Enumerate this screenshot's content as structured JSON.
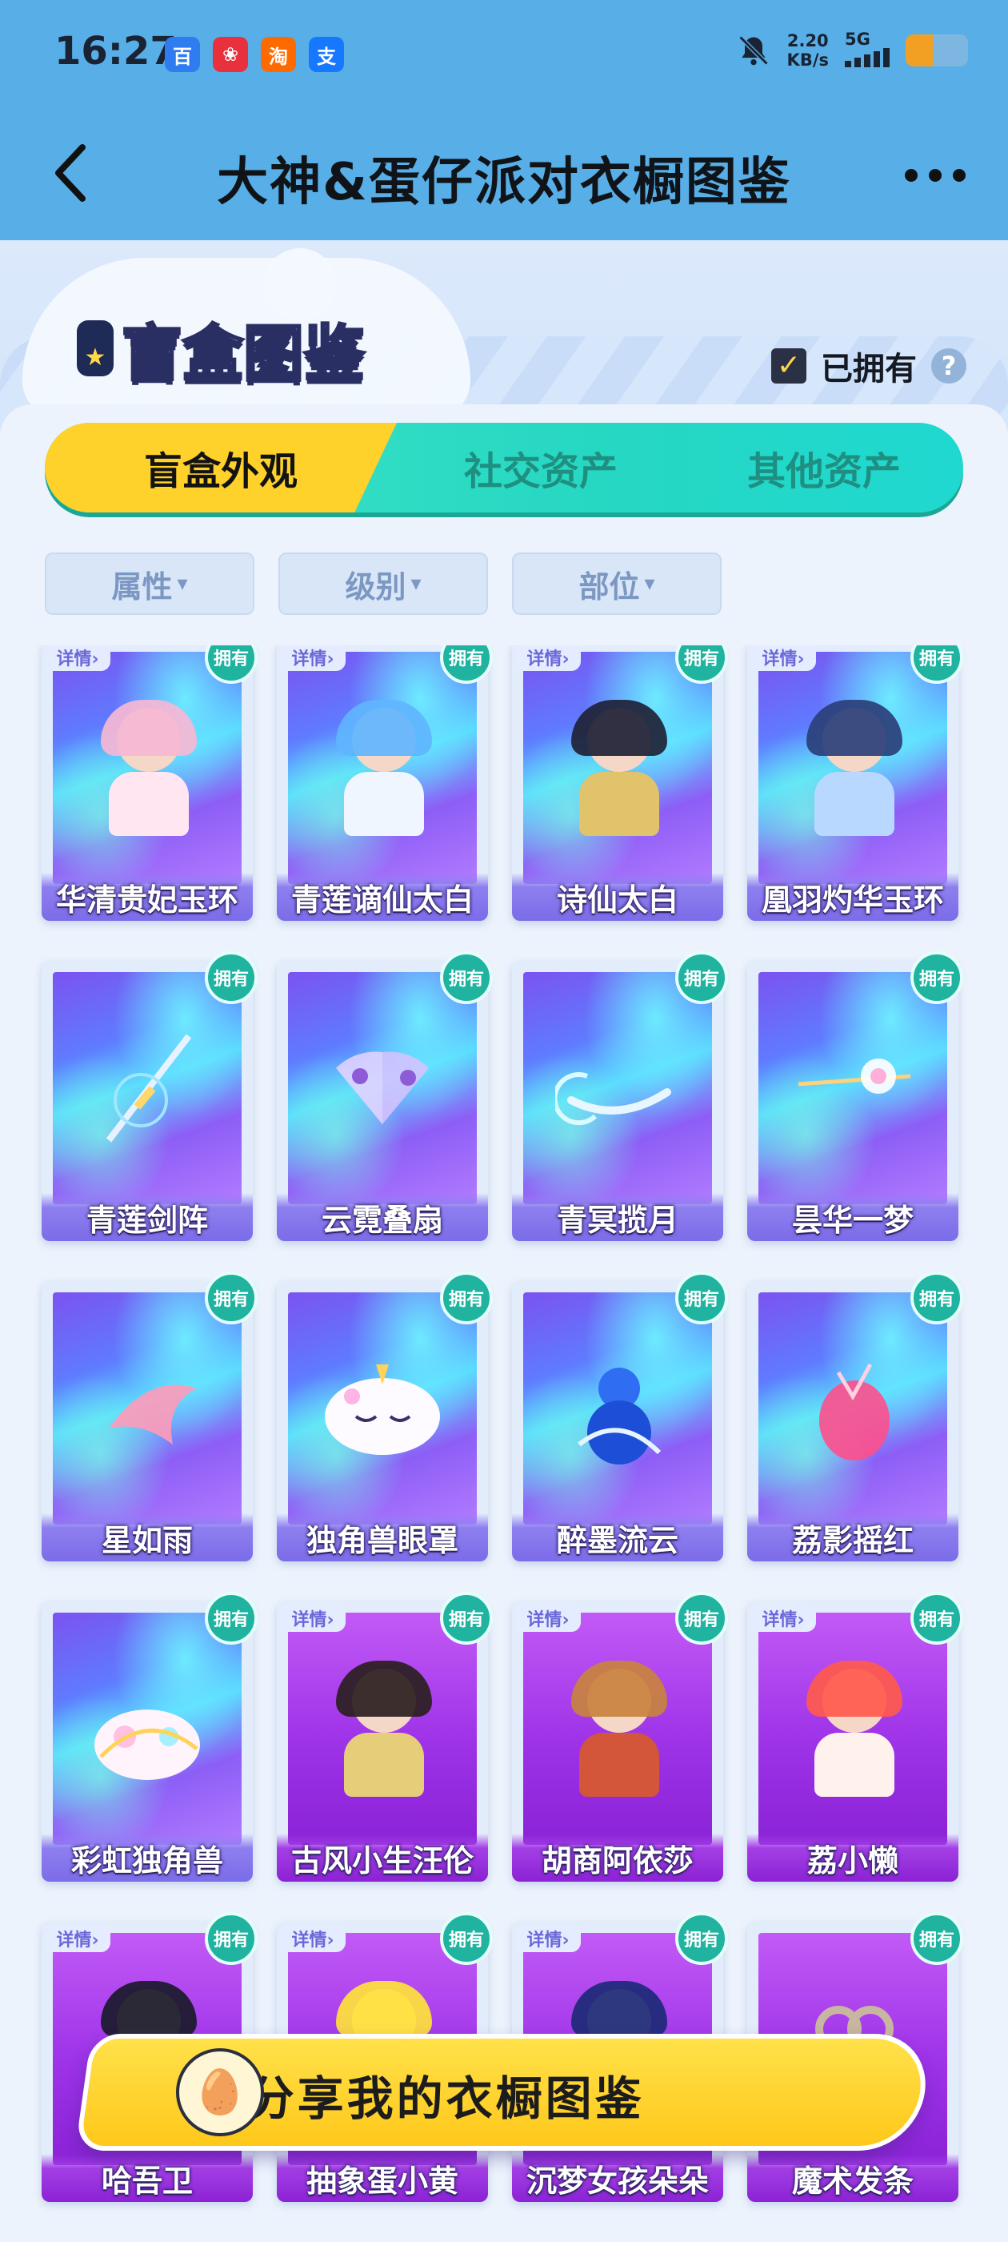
{
  "status_bar": {
    "time": "16:27",
    "apps": [
      {
        "name": "baidu",
        "glyph": "百",
        "color": "#2f7bf0"
      },
      {
        "name": "app-red",
        "glyph": "❀",
        "color": "#e8313c"
      },
      {
        "name": "taobao",
        "glyph": "淘",
        "color": "#ff6a00"
      },
      {
        "name": "alipay",
        "glyph": "支",
        "color": "#1677ff"
      }
    ],
    "net_speed_value": "2.20",
    "net_speed_unit": "KB/s",
    "signal": "5G"
  },
  "header": {
    "back_glyph": "‹",
    "title": "大神&蛋仔派对衣橱图鉴",
    "more_glyph": "•••"
  },
  "hero": {
    "logo_text": "盲盒图鉴",
    "owned_label": "已拥有",
    "owned_checked": true,
    "check_glyph": "✓",
    "help_glyph": "?"
  },
  "tabs": [
    {
      "label": "盲盒外观",
      "active": true
    },
    {
      "label": "社交资产",
      "active": false
    },
    {
      "label": "其他资产",
      "active": false
    }
  ],
  "filters": [
    {
      "label": "属性",
      "caret": "▾"
    },
    {
      "label": "级别",
      "caret": "▾"
    },
    {
      "label": "部位",
      "caret": "▾"
    }
  ],
  "badges": {
    "owned": "拥有",
    "detail": "详情›"
  },
  "items": [
    {
      "name": "华清贵妃玉环",
      "owned": true,
      "detail": true,
      "style": "holo",
      "icon": "pink-hair-character"
    },
    {
      "name": "青莲谪仙太白",
      "owned": true,
      "detail": true,
      "style": "holo",
      "icon": "blue-hair-character"
    },
    {
      "name": "诗仙太白",
      "owned": true,
      "detail": true,
      "style": "holo",
      "icon": "black-hair-character"
    },
    {
      "name": "凰羽灼华玉环",
      "owned": true,
      "detail": true,
      "style": "holo",
      "icon": "veiled-character"
    },
    {
      "name": "青莲剑阵",
      "owned": true,
      "detail": false,
      "style": "holo",
      "icon": "sword"
    },
    {
      "name": "云霓叠扇",
      "owned": true,
      "detail": false,
      "style": "holo",
      "icon": "fans"
    },
    {
      "name": "青冥揽月",
      "owned": true,
      "detail": false,
      "style": "holo",
      "icon": "crescent"
    },
    {
      "name": "昙华一梦",
      "owned": true,
      "detail": false,
      "style": "holo",
      "icon": "hairpin-flower"
    },
    {
      "name": "星如雨",
      "owned": true,
      "detail": false,
      "style": "holo",
      "icon": "fish-tail"
    },
    {
      "name": "独角兽眼罩",
      "owned": true,
      "detail": false,
      "style": "holo",
      "icon": "unicorn-eye-mask"
    },
    {
      "name": "醉墨流云",
      "owned": true,
      "detail": false,
      "style": "holo",
      "icon": "gourd"
    },
    {
      "name": "荔影摇红",
      "owned": true,
      "detail": false,
      "style": "holo",
      "icon": "lychee-ornament"
    },
    {
      "name": "彩虹独角兽",
      "owned": true,
      "detail": false,
      "style": "holo",
      "icon": "rainbow-unicorn"
    },
    {
      "name": "古风小生汪伦",
      "owned": true,
      "detail": true,
      "style": "purple",
      "icon": "scholar-character"
    },
    {
      "name": "胡商阿依莎",
      "owned": true,
      "detail": true,
      "style": "purple",
      "icon": "merchant-character"
    },
    {
      "name": "荔小懒",
      "owned": true,
      "detail": true,
      "style": "purple",
      "icon": "lychee-character"
    },
    {
      "name": "哈吾卫",
      "owned": true,
      "detail": true,
      "style": "purple",
      "icon": "guard-character"
    },
    {
      "name": "抽象蛋小黄",
      "owned": true,
      "detail": true,
      "style": "purple",
      "icon": "yellow-egg-character"
    },
    {
      "name": "沉梦女孩朵朵",
      "owned": true,
      "detail": true,
      "style": "purple",
      "icon": "dream-girl-character"
    },
    {
      "name": "魔术发条",
      "owned": true,
      "detail": false,
      "style": "purple",
      "icon": "wind-up-key"
    }
  ],
  "share": {
    "label": "分享我的衣橱图鉴",
    "icon": "egg-mascot"
  },
  "colors": {
    "header_bg": "#58aee6",
    "tab_active": "#ffd12b",
    "tab_bg": "#26d7c2",
    "owned_badge": "#1fb3a0"
  }
}
